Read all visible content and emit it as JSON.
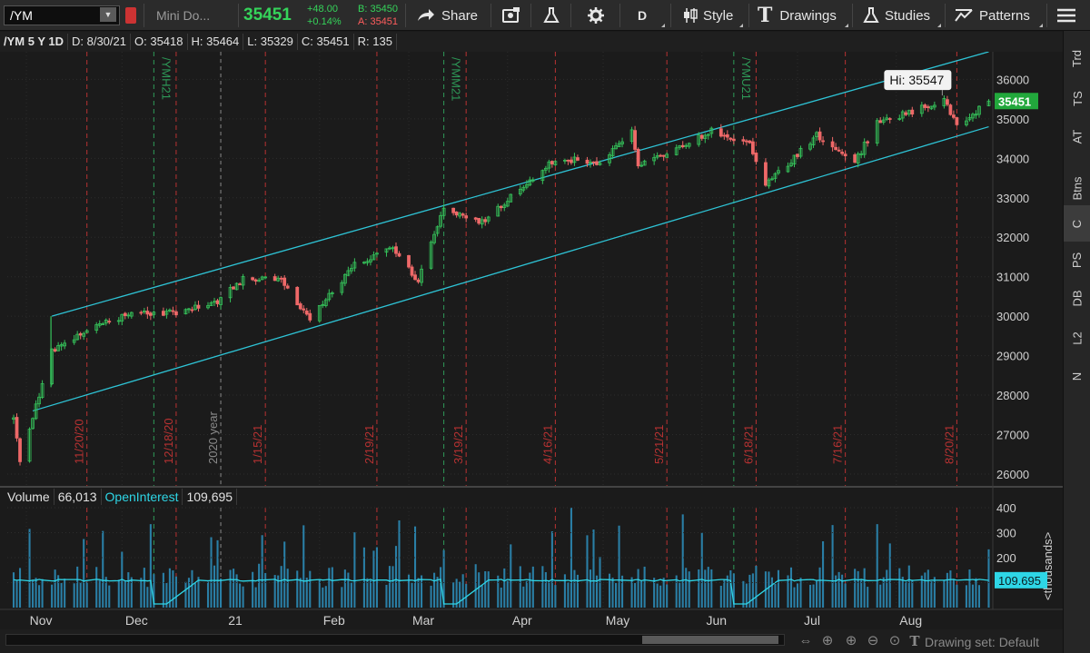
{
  "toolbar": {
    "symbol": "/YM",
    "description": "Mini Do...",
    "last": "35451",
    "change": "+48.00",
    "change_pct": "+0.14%",
    "bid": "B: 35450",
    "ask": "A: 35451",
    "share_label": "Share",
    "period_label": "D",
    "style_label": "Style",
    "drawings_label": "Drawings",
    "studies_label": "Studies",
    "patterns_label": "Patterns"
  },
  "side_tabs": [
    "Trd",
    "TS",
    "AT",
    "Btns",
    "C",
    "PS",
    "DB",
    "L2",
    "N"
  ],
  "chart_header": {
    "symbol": "/YM 5 Y 1D",
    "date": "D: 8/30/21",
    "open": "O: 35418",
    "high": "H: 35464",
    "low": "L: 35329",
    "close": "C: 35451",
    "range": "R: 135"
  },
  "volume_header": {
    "volume_label": "Volume",
    "volume_value": "66,013",
    "oi_label": "OpenInterest",
    "oi_value": "109,695"
  },
  "bottom": {
    "drawing_set": "Drawing set: Default"
  },
  "colors": {
    "up": "#35c25a",
    "down": "#ee6868",
    "channel": "#2ec4d6",
    "volume": "#2a7fa6",
    "oi_line": "#2ed6e6",
    "grid": "#2c2c2c",
    "price_tag": "#22a83c"
  },
  "chart_data": [
    {
      "type": "candlestick",
      "title": "",
      "ylim": [
        25700,
        36700
      ],
      "yticks": [
        26000,
        27000,
        28000,
        29000,
        30000,
        31000,
        32000,
        33000,
        34000,
        35000,
        36000
      ],
      "xticks": [
        "Nov",
        "Dec",
        "21",
        "Feb",
        "Mar",
        "Apr",
        "May",
        "Jun",
        "Jul",
        "Aug"
      ],
      "waypoints": [
        [
          "2020-10-28",
          27400
        ],
        [
          "2020-10-30",
          26300
        ],
        [
          "2020-11-04",
          27700
        ],
        [
          "2020-11-09",
          29100
        ],
        [
          "2020-11-13",
          29300
        ],
        [
          "2020-11-24",
          29800
        ],
        [
          "2020-12-04",
          30050
        ],
        [
          "2020-12-18",
          30100
        ],
        [
          "2020-12-30",
          30300
        ],
        [
          "2021-01-08",
          30950
        ],
        [
          "2021-01-20",
          30900
        ],
        [
          "2021-01-29",
          29900
        ],
        [
          "2021-02-12",
          31300
        ],
        [
          "2021-02-24",
          31700
        ],
        [
          "2021-03-04",
          30900
        ],
        [
          "2021-03-12",
          32700
        ],
        [
          "2021-03-24",
          32400
        ],
        [
          "2021-04-01",
          32950
        ],
        [
          "2021-04-16",
          34000
        ],
        [
          "2021-04-30",
          33900
        ],
        [
          "2021-05-10",
          34700
        ],
        [
          "2021-05-12",
          33800
        ],
        [
          "2021-05-21",
          34100
        ],
        [
          "2021-06-04",
          34700
        ],
        [
          "2021-06-16",
          34400
        ],
        [
          "2021-06-21",
          33300
        ],
        [
          "2021-07-07",
          34600
        ],
        [
          "2021-07-19",
          33900
        ],
        [
          "2021-07-26",
          34900
        ],
        [
          "2021-08-16",
          35450
        ],
        [
          "2021-08-20",
          34800
        ],
        [
          "2021-08-30",
          35451
        ]
      ],
      "channel": {
        "upper": [
          [
            "2020-11-09",
            30000
          ],
          [
            "2021-08-30",
            36700
          ]
        ],
        "lower": [
          [
            "2020-11-03",
            27600
          ],
          [
            "2021-08-30",
            34800
          ]
        ]
      },
      "annotations": [
        {
          "label": "Hi: 35547",
          "x": "2021-08-16",
          "y": 35547
        }
      ],
      "current_price": 35451,
      "vertical_markers": [
        {
          "date": "2020-11-20",
          "label": "11/20/20",
          "kind": "expiry"
        },
        {
          "date": "2020-12-11",
          "label": "/YMH21",
          "kind": "roll"
        },
        {
          "date": "2020-12-18",
          "label": "12/18/20",
          "kind": "expiry"
        },
        {
          "date": "2021-01-01",
          "label": "2020 year",
          "kind": "year"
        },
        {
          "date": "2021-01-15",
          "label": "1/15/21",
          "kind": "expiry"
        },
        {
          "date": "2021-02-19",
          "label": "2/19/21",
          "kind": "expiry"
        },
        {
          "date": "2021-03-12",
          "label": "/YMM21",
          "kind": "roll"
        },
        {
          "date": "2021-03-19",
          "label": "3/19/21",
          "kind": "expiry"
        },
        {
          "date": "2021-04-16",
          "label": "4/16/21",
          "kind": "expiry"
        },
        {
          "date": "2021-05-21",
          "label": "5/21/21",
          "kind": "expiry"
        },
        {
          "date": "2021-06-11",
          "label": "/YMU21",
          "kind": "roll"
        },
        {
          "date": "2021-06-18",
          "label": "6/18/21",
          "kind": "expiry"
        },
        {
          "date": "2021-07-16",
          "label": "7/16/21",
          "kind": "expiry"
        },
        {
          "date": "2021-08-20",
          "label": "8/20/21",
          "kind": "expiry"
        }
      ]
    },
    {
      "type": "bar",
      "title": "",
      "ylabel": "<thousands>",
      "ylim": [
        0,
        400
      ],
      "yticks": [
        100,
        200,
        300,
        400
      ],
      "open_interest_last": "109.695",
      "open_interest_level": 109.695,
      "open_interest_dips": [
        "2020-12-11",
        "2021-03-12",
        "2021-06-11"
      ]
    }
  ]
}
